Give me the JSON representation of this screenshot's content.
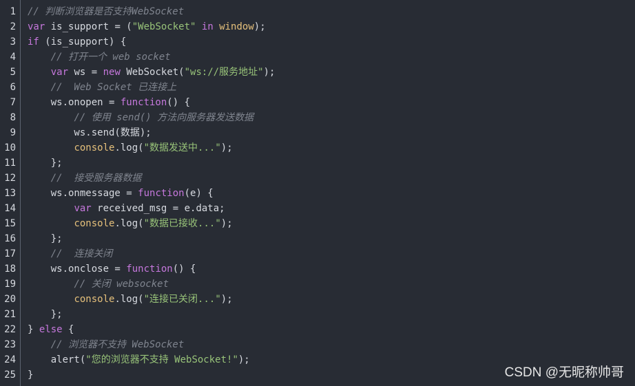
{
  "editor": {
    "language": "javascript",
    "colors": {
      "background": "#282c34",
      "text": "#d7dae0",
      "comment": "#7f848e",
      "keyword": "#c678dd",
      "string": "#98c379",
      "builtin": "#e5c07b",
      "gutter_divider": "#5c6370"
    },
    "lines": [
      {
        "n": "1",
        "tokens": [
          {
            "t": "// 判断浏览器是否支持WebSocket",
            "k": "comment"
          }
        ]
      },
      {
        "n": "2",
        "tokens": [
          {
            "t": "var",
            "k": "keyword"
          },
          {
            "t": " is_support = (",
            "k": "plain"
          },
          {
            "t": "\"WebSocket\"",
            "k": "string"
          },
          {
            "t": " ",
            "k": "plain"
          },
          {
            "t": "in",
            "k": "keyword"
          },
          {
            "t": " ",
            "k": "plain"
          },
          {
            "t": "window",
            "k": "builtin"
          },
          {
            "t": ");",
            "k": "plain"
          }
        ]
      },
      {
        "n": "3",
        "tokens": [
          {
            "t": "if",
            "k": "keyword"
          },
          {
            "t": " (is_support) {",
            "k": "plain"
          }
        ]
      },
      {
        "n": "4",
        "tokens": [
          {
            "t": "    ",
            "k": "plain"
          },
          {
            "t": "// 打开一个 web socket",
            "k": "comment"
          }
        ]
      },
      {
        "n": "5",
        "tokens": [
          {
            "t": "    ",
            "k": "plain"
          },
          {
            "t": "var",
            "k": "keyword"
          },
          {
            "t": " ws = ",
            "k": "plain"
          },
          {
            "t": "new",
            "k": "keyword"
          },
          {
            "t": " WebSocket(",
            "k": "plain"
          },
          {
            "t": "\"ws://服务地址\"",
            "k": "string"
          },
          {
            "t": ");",
            "k": "plain"
          }
        ]
      },
      {
        "n": "6",
        "tokens": [
          {
            "t": "    ",
            "k": "plain"
          },
          {
            "t": "//  Web Socket 已连接上",
            "k": "comment"
          }
        ]
      },
      {
        "n": "7",
        "tokens": [
          {
            "t": "    ws.onopen = ",
            "k": "plain"
          },
          {
            "t": "function",
            "k": "keyword"
          },
          {
            "t": "() {",
            "k": "plain"
          }
        ]
      },
      {
        "n": "8",
        "tokens": [
          {
            "t": "        ",
            "k": "plain"
          },
          {
            "t": "// 使用 send() 方法向服务器发送数据",
            "k": "comment"
          }
        ]
      },
      {
        "n": "9",
        "tokens": [
          {
            "t": "        ws.send(数据);",
            "k": "plain"
          }
        ]
      },
      {
        "n": "10",
        "tokens": [
          {
            "t": "        ",
            "k": "plain"
          },
          {
            "t": "console",
            "k": "builtin"
          },
          {
            "t": ".log(",
            "k": "plain"
          },
          {
            "t": "\"数据发送中...\"",
            "k": "string"
          },
          {
            "t": ");",
            "k": "plain"
          }
        ]
      },
      {
        "n": "11",
        "tokens": [
          {
            "t": "    };",
            "k": "plain"
          }
        ]
      },
      {
        "n": "12",
        "tokens": [
          {
            "t": "    ",
            "k": "plain"
          },
          {
            "t": "//  接受服务器数据",
            "k": "comment"
          }
        ]
      },
      {
        "n": "13",
        "tokens": [
          {
            "t": "    ws.onmessage = ",
            "k": "plain"
          },
          {
            "t": "function",
            "k": "keyword"
          },
          {
            "t": "(e) {",
            "k": "plain"
          }
        ]
      },
      {
        "n": "14",
        "tokens": [
          {
            "t": "        ",
            "k": "plain"
          },
          {
            "t": "var",
            "k": "keyword"
          },
          {
            "t": " received_msg = e.data;",
            "k": "plain"
          }
        ]
      },
      {
        "n": "15",
        "tokens": [
          {
            "t": "        ",
            "k": "plain"
          },
          {
            "t": "console",
            "k": "builtin"
          },
          {
            "t": ".log(",
            "k": "plain"
          },
          {
            "t": "\"数据已接收...\"",
            "k": "string"
          },
          {
            "t": ");",
            "k": "plain"
          }
        ]
      },
      {
        "n": "16",
        "tokens": [
          {
            "t": "    };",
            "k": "plain"
          }
        ]
      },
      {
        "n": "17",
        "tokens": [
          {
            "t": "    ",
            "k": "plain"
          },
          {
            "t": "//  连接关闭",
            "k": "comment"
          }
        ]
      },
      {
        "n": "18",
        "tokens": [
          {
            "t": "    ws.onclose = ",
            "k": "plain"
          },
          {
            "t": "function",
            "k": "keyword"
          },
          {
            "t": "() {",
            "k": "plain"
          }
        ]
      },
      {
        "n": "19",
        "tokens": [
          {
            "t": "        ",
            "k": "plain"
          },
          {
            "t": "// 关闭 websocket",
            "k": "comment"
          }
        ]
      },
      {
        "n": "20",
        "tokens": [
          {
            "t": "        ",
            "k": "plain"
          },
          {
            "t": "console",
            "k": "builtin"
          },
          {
            "t": ".log(",
            "k": "plain"
          },
          {
            "t": "\"连接已关闭...\"",
            "k": "string"
          },
          {
            "t": ");",
            "k": "plain"
          }
        ]
      },
      {
        "n": "21",
        "tokens": [
          {
            "t": "    };",
            "k": "plain"
          }
        ]
      },
      {
        "n": "22",
        "tokens": [
          {
            "t": "} ",
            "k": "plain"
          },
          {
            "t": "else",
            "k": "keyword"
          },
          {
            "t": " {",
            "k": "plain"
          }
        ]
      },
      {
        "n": "23",
        "tokens": [
          {
            "t": "    ",
            "k": "plain"
          },
          {
            "t": "// 浏览器不支持 WebSocket",
            "k": "comment"
          }
        ]
      },
      {
        "n": "24",
        "tokens": [
          {
            "t": "    alert(",
            "k": "plain"
          },
          {
            "t": "\"您的浏览器不支持 WebSocket!\"",
            "k": "string"
          },
          {
            "t": ");",
            "k": "plain"
          }
        ]
      },
      {
        "n": "25",
        "tokens": [
          {
            "t": "}",
            "k": "plain"
          }
        ]
      }
    ]
  },
  "watermark": "CSDN @无昵称帅哥"
}
